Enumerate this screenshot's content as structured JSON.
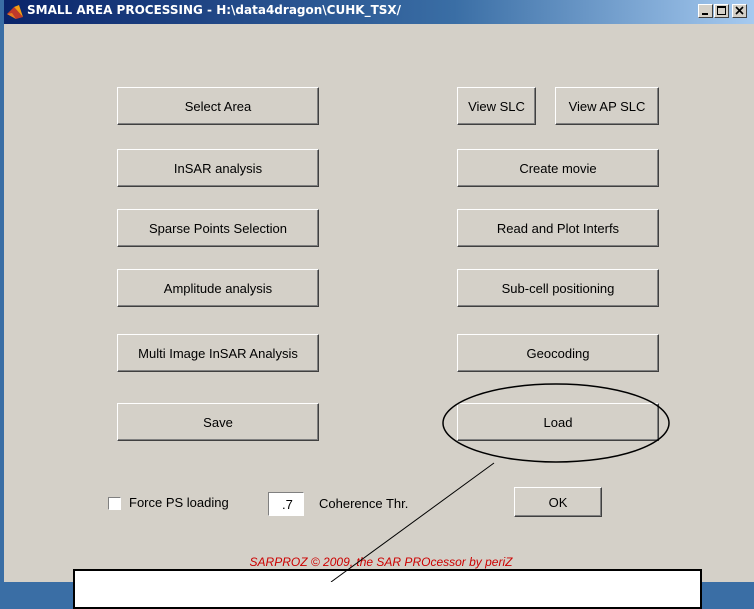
{
  "window": {
    "title": "SMALL AREA PROCESSING - H:\\data4dragon\\CUHK_TSX/",
    "controls": [
      "minimize-icon",
      "maximize-icon",
      "close-icon"
    ]
  },
  "buttons": {
    "select_area": "Select Area",
    "insar_analysis": "InSAR analysis",
    "sparse_points": "Sparse Points Selection",
    "amplitude_analysis": "Amplitude analysis",
    "multi_image": "Multi Image InSAR Analysis",
    "save": "Save",
    "view_slc": "View SLC",
    "view_ap_slc": "View AP SLC",
    "create_movie": "Create movie",
    "read_plot": "Read and Plot Interfs",
    "subcell": "Sub-cell positioning",
    "geocoding": "Geocoding",
    "load": "Load",
    "ok": "OK"
  },
  "options": {
    "force_ps_label": "Force PS loading",
    "force_ps_checked": false,
    "coherence_value": ".7",
    "coherence_label": "Coherence Thr."
  },
  "footer": "SARPROZ © 2009, the SAR PROcessor by periZ",
  "colors": {
    "footer": "#cc0000",
    "face": "#d4d0c8",
    "title_bar": "#0a246a"
  }
}
